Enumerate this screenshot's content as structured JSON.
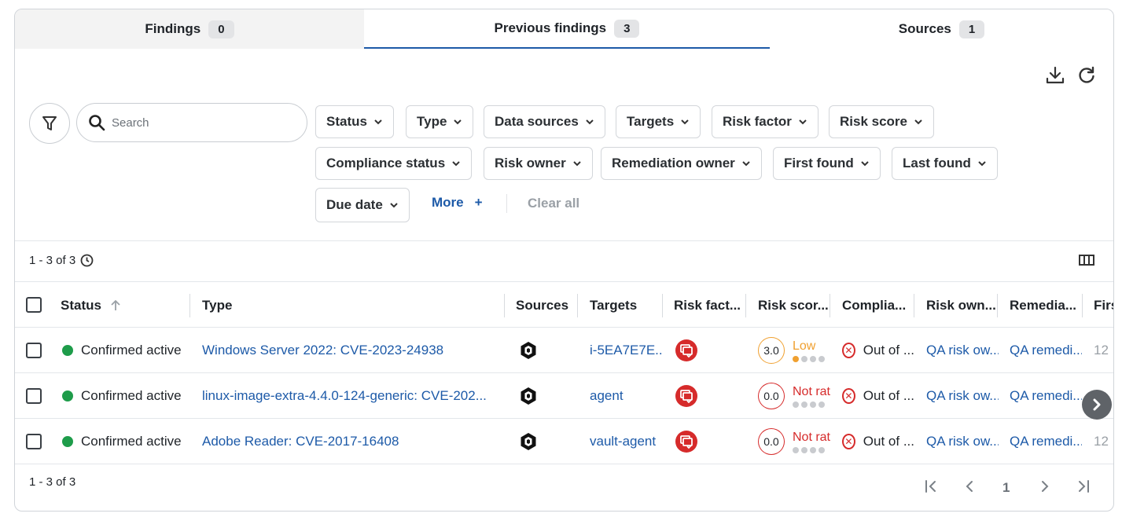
{
  "tabs": [
    {
      "label": "Findings",
      "count": "0"
    },
    {
      "label": "Previous findings",
      "count": "3"
    },
    {
      "label": "Sources",
      "count": "1"
    }
  ],
  "toolbar": {
    "download_icon": "download-icon",
    "refresh_icon": "refresh-icon"
  },
  "search": {
    "placeholder": "Search"
  },
  "filters": {
    "status": "Status",
    "type": "Type",
    "data_sources": "Data sources",
    "targets": "Targets",
    "risk_factor": "Risk factor",
    "risk_score": "Risk score",
    "compliance_status": "Compliance status",
    "risk_owner": "Risk owner",
    "remediation_owner": "Remediation owner",
    "first_found": "First found",
    "last_found": "Last found",
    "due_date": "Due date",
    "more": "More",
    "more_plus": "+",
    "clear_all": "Clear all"
  },
  "results": {
    "count_top": "1 - 3 of 3",
    "count_bottom": "1 - 3 of 3"
  },
  "table": {
    "headers": {
      "status": "Status",
      "type": "Type",
      "sources": "Sources",
      "targets": "Targets",
      "risk_factor": "Risk fact...",
      "risk_score": "Risk scor...",
      "compliance": "Complia...",
      "risk_owner": "Risk own...",
      "remediation": "Remedia...",
      "first": "Firs"
    },
    "rows": [
      {
        "status": "Confirmed active",
        "type": "Windows Server 2022: CVE-2023-24938",
        "target": "i-5EA7E7E...",
        "score": "3.0",
        "score_label": "Low",
        "compliance": "Out of ...",
        "risk_owner": "QA risk ow...",
        "remediation": "QA remedi...",
        "first": "12"
      },
      {
        "status": "Confirmed active",
        "type": "linux-image-extra-4.4.0-124-generic: CVE-202...",
        "target": "agent",
        "score": "0.0",
        "score_label": "Not rat",
        "compliance": "Out of ...",
        "risk_owner": "QA risk ow...",
        "remediation": "QA remedi...",
        "first": ""
      },
      {
        "status": "Confirmed active",
        "type": "Adobe Reader: CVE-2017-16408",
        "target": "vault-agent",
        "score": "0.0",
        "score_label": "Not rat",
        "compliance": "Out of ...",
        "risk_owner": "QA risk ow...",
        "remediation": "QA remedi...",
        "first": "12"
      }
    ]
  },
  "pagination": {
    "page": "1"
  },
  "colors": {
    "accent": "#1d5aa8",
    "active": "#1e9c4a",
    "danger": "#d62b2b",
    "low": "#f0a030"
  }
}
